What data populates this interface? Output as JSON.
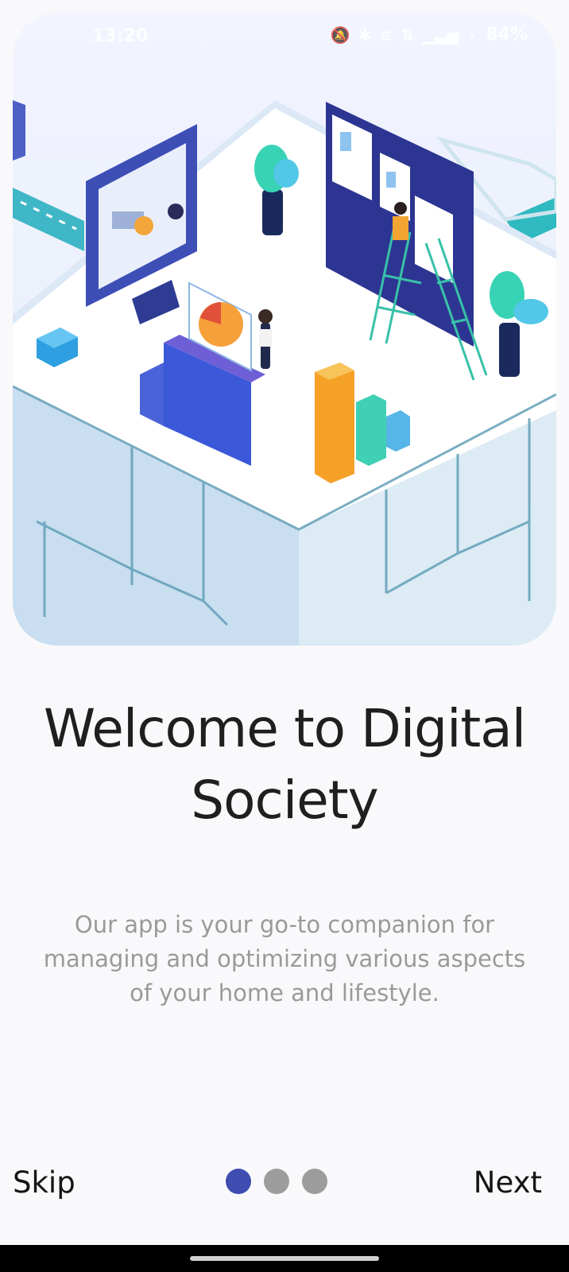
{
  "status_bar": {
    "time": "13:20",
    "battery": "84%",
    "icons": [
      "mute-icon",
      "bluetooth-icon",
      "wifi-icon",
      "data-icon",
      "signal-icon",
      "charging-icon"
    ]
  },
  "hero": {
    "illustration": "isometric-digital-office-illustration"
  },
  "onboarding": {
    "title_line1": "Welcome to Digital",
    "title_line2": "Society",
    "description_line1": "Our app is your go-to companion for",
    "description_line2": "managing and optimizing various aspects",
    "description_line3": "of your home and lifestyle."
  },
  "footer": {
    "skip_label": "Skip",
    "next_label": "Next",
    "pages_total": 3,
    "current_page": 1
  },
  "colors": {
    "background": "#f9f9fb",
    "accent": "#3f4cb0",
    "dot_inactive": "#9c9c9c",
    "title": "#1f1f1f",
    "description": "#9a9a9a"
  }
}
